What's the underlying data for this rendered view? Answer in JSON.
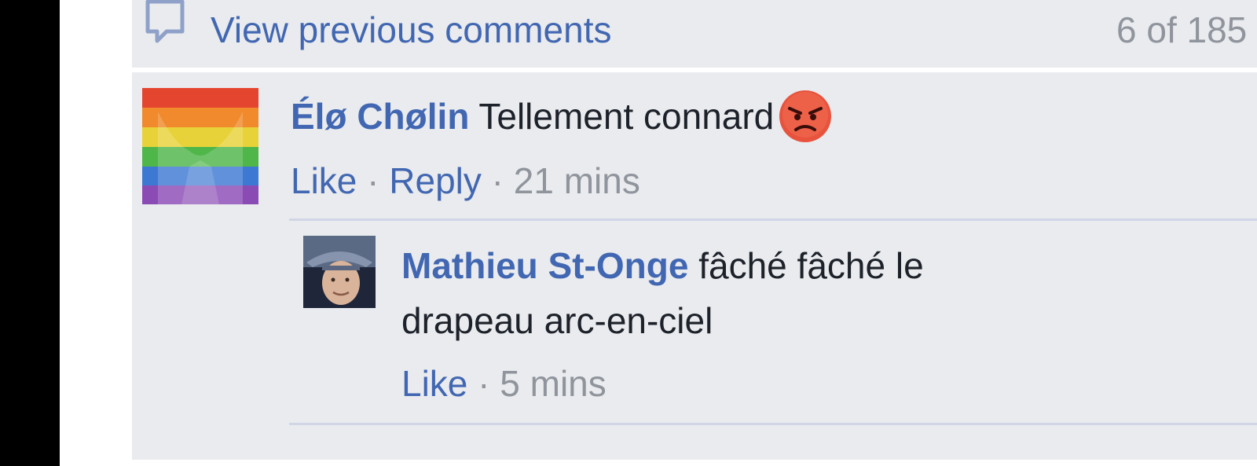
{
  "previous": {
    "label": "View previous comments",
    "count": "6 of 185"
  },
  "comments": [
    {
      "author": "Élø Chølin",
      "text": "Tellement connard",
      "emoji": "angry-face-emoji",
      "actions": {
        "like": "Like",
        "reply": "Reply",
        "separator": "·",
        "time": "21 mins"
      },
      "reply": {
        "author": "Mathieu St-Onge",
        "text_line1": "fâché fâché le",
        "text_line2": "drapeau arc-en-ciel",
        "actions": {
          "like": "Like",
          "separator": "·",
          "time": "5 mins"
        }
      }
    }
  ],
  "colors": {
    "link": "#4267b2",
    "meta": "#90949c",
    "panel": "#e9ebee",
    "text": "#1d2129"
  }
}
